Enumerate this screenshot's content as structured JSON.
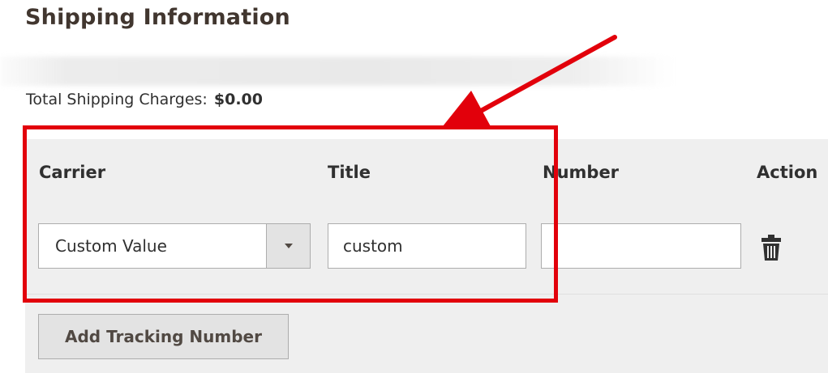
{
  "section": {
    "title": "Shipping Information"
  },
  "totals": {
    "label": "Total Shipping Charges:",
    "amount": "$0.00"
  },
  "tracking": {
    "columns": {
      "carrier": "Carrier",
      "title": "Title",
      "number": "Number",
      "action": "Action"
    },
    "row": {
      "carrier_selected": "Custom Value",
      "title_value": "custom",
      "number_value": ""
    },
    "add_button_label": "Add Tracking Number"
  },
  "icons": {
    "select_arrow": "chevron-down-icon",
    "delete": "trash-icon"
  },
  "annotation": {
    "highlight_color": "#e2000b",
    "arrow_color": "#e2000b"
  }
}
